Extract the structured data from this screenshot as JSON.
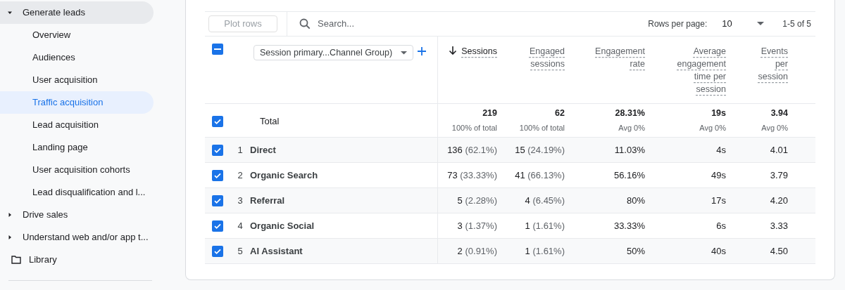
{
  "sidebar": {
    "items": [
      {
        "label": "Generate leads",
        "expanded": true,
        "selected": false,
        "children": [
          {
            "label": "Overview",
            "selected": false
          },
          {
            "label": "Audiences",
            "selected": false
          },
          {
            "label": "User acquisition",
            "selected": false
          },
          {
            "label": "Traffic acquisition",
            "selected": true
          },
          {
            "label": "Lead acquisition",
            "selected": false
          },
          {
            "label": "Landing page",
            "selected": false
          },
          {
            "label": "User acquisition cohorts",
            "selected": false
          },
          {
            "label": "Lead disqualification and l...",
            "selected": false
          }
        ]
      },
      {
        "label": "Drive sales",
        "expanded": false,
        "selected": false
      },
      {
        "label": "Understand web and/or app t...",
        "expanded": false,
        "selected": false
      }
    ],
    "library": {
      "label": "Library"
    }
  },
  "toolbar": {
    "plot_rows": {
      "label": "Plot rows",
      "disabled": true
    },
    "search": {
      "placeholder": "Search..."
    },
    "rows_per_page": {
      "label": "Rows per page:",
      "value": "10"
    },
    "range": "1-5 of 5"
  },
  "table": {
    "select_all": {
      "indeterminate": true
    },
    "dimension": {
      "label": "Session primary...Channel Group)"
    },
    "columns": [
      {
        "label": "Sessions",
        "sorted": true
      },
      {
        "label": "Engaged sessions",
        "sorted": false
      },
      {
        "label": "Engagement rate",
        "sorted": false
      },
      {
        "label": "Average engagement time per session",
        "sorted": false
      },
      {
        "label": "Events per session",
        "sorted": false
      }
    ],
    "total": {
      "label": "Total",
      "checked": true,
      "cells": [
        {
          "value": "219",
          "note": "100% of total"
        },
        {
          "value": "62",
          "note": "100% of total"
        },
        {
          "value": "28.31%",
          "note": "Avg 0%"
        },
        {
          "value": "19s",
          "note": "Avg 0%"
        },
        {
          "value": "3.94",
          "note": "Avg 0%"
        }
      ]
    },
    "rows": [
      {
        "index": "1",
        "name": "Direct",
        "checked": true,
        "cells": [
          {
            "value": "136",
            "share": "(62.1%)"
          },
          {
            "value": "15",
            "share": "(24.19%)"
          },
          {
            "value": "11.03%"
          },
          {
            "value": "4s"
          },
          {
            "value": "4.01"
          }
        ]
      },
      {
        "index": "2",
        "name": "Organic Search",
        "checked": true,
        "cells": [
          {
            "value": "73",
            "share": "(33.33%)"
          },
          {
            "value": "41",
            "share": "(66.13%)"
          },
          {
            "value": "56.16%"
          },
          {
            "value": "49s"
          },
          {
            "value": "3.79"
          }
        ]
      },
      {
        "index": "3",
        "name": "Referral",
        "checked": true,
        "cells": [
          {
            "value": "5",
            "share": "(2.28%)"
          },
          {
            "value": "4",
            "share": "(6.45%)"
          },
          {
            "value": "80%"
          },
          {
            "value": "17s"
          },
          {
            "value": "4.20"
          }
        ]
      },
      {
        "index": "4",
        "name": "Organic Social",
        "checked": true,
        "cells": [
          {
            "value": "3",
            "share": "(1.37%)"
          },
          {
            "value": "1",
            "share": "(1.61%)"
          },
          {
            "value": "33.33%"
          },
          {
            "value": "6s"
          },
          {
            "value": "3.33"
          }
        ]
      },
      {
        "index": "5",
        "name": "AI Assistant",
        "checked": true,
        "cells": [
          {
            "value": "2",
            "share": "(0.91%)"
          },
          {
            "value": "1",
            "share": "(1.61%)"
          },
          {
            "value": "50%"
          },
          {
            "value": "40s"
          },
          {
            "value": "4.50"
          }
        ]
      }
    ]
  }
}
